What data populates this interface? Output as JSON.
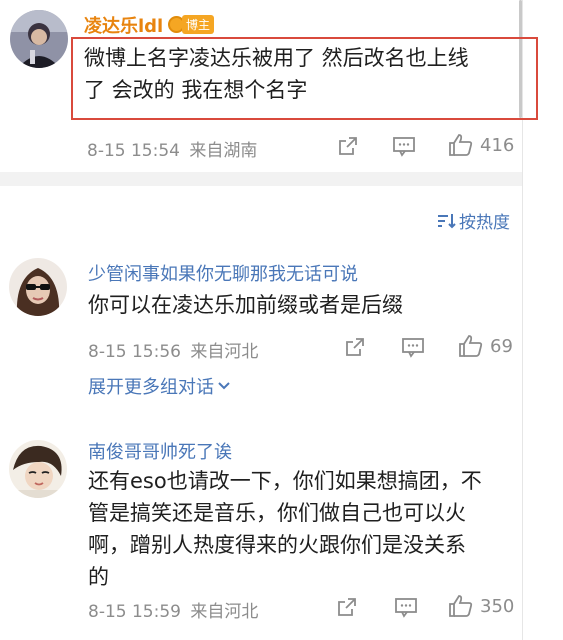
{
  "comments": [
    {
      "username": "凌达乐ldl",
      "badge": "博主",
      "text_lines": [
        "微博上名字凌达乐被用了 然后改名也上线",
        "了 会改的 我在想个名字"
      ],
      "timestamp": "8-15 15:54",
      "location": "来自湖南",
      "likes": "416"
    },
    {
      "username": "少管闲事如果你无聊那我无话可说",
      "text_lines": [
        "你可以在凌达乐加前缀或者是后缀"
      ],
      "timestamp": "8-15 15:56",
      "location": "来自河北",
      "likes": "69"
    },
    {
      "username": "南俊哥哥帅死了诶",
      "text_lines": [
        "还有eso也请改一下，你们如果想搞团，不",
        "管是搞笑还是音乐，你们做自己也可以火",
        "啊，蹭别人热度得来的火跟你们是没关系",
        "的"
      ],
      "timestamp": "8-15 15:59",
      "location": "来自河北",
      "likes": "350"
    }
  ],
  "sort_label": "按热度",
  "expand_label": "展开更多组对话",
  "colors": {
    "link_blue": "#4a77b8",
    "owner_orange": "#e8840f",
    "highlight_red": "#d94a3c",
    "meta_gray": "#8c8c8c"
  },
  "icons": [
    "share-icon",
    "comment-icon",
    "like-icon",
    "sort-icon",
    "chevron-down-icon"
  ]
}
